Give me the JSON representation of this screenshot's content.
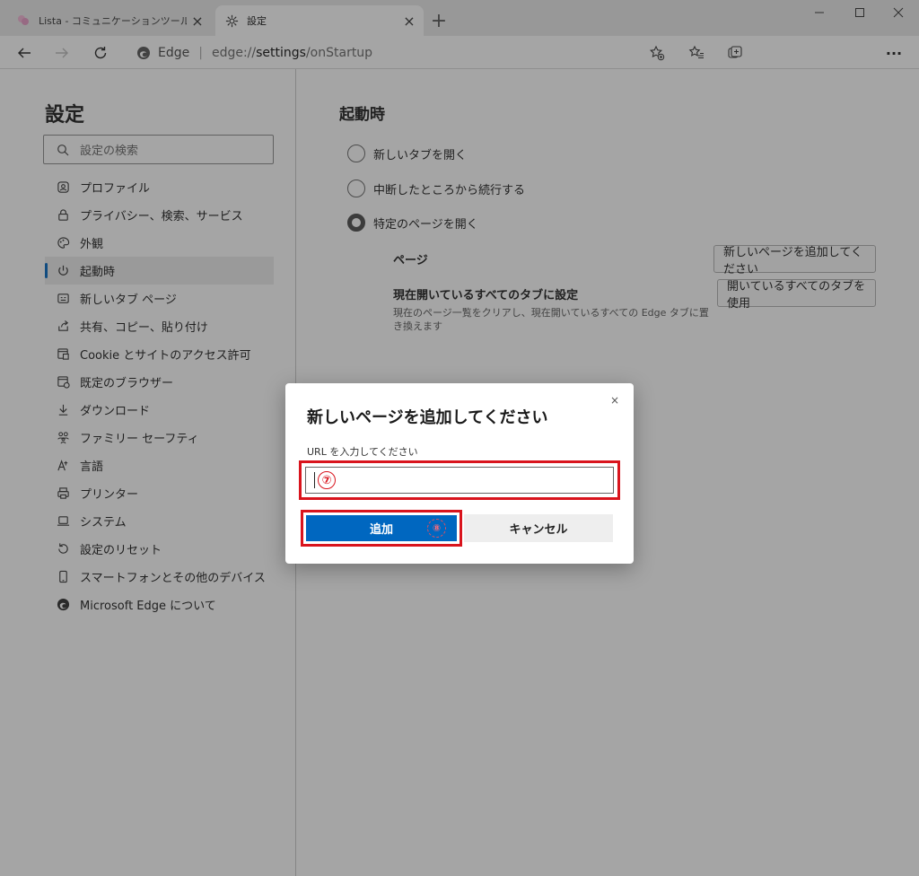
{
  "tabs": [
    {
      "title": "Lista - コミュニケーションツール",
      "close": "×"
    },
    {
      "title": "設定",
      "close": "×"
    }
  ],
  "new_tab_label": "+",
  "window_controls": {
    "minimize": "—",
    "maximize": "☐",
    "close": "✕"
  },
  "address": {
    "edge_label": "Edge",
    "separator": "|",
    "url_proto": "edge://",
    "url_host": "settings",
    "url_path": "/onStartup"
  },
  "toolbar": {
    "more": "···"
  },
  "sidebar": {
    "title": "設定",
    "search_placeholder": "設定の検索",
    "items": [
      {
        "label": "プロファイル",
        "icon": "profile-icon"
      },
      {
        "label": "プライバシー、検索、サービス",
        "icon": "lock-icon"
      },
      {
        "label": "外観",
        "icon": "palette-icon"
      },
      {
        "label": "起動時",
        "icon": "power-icon"
      },
      {
        "label": "新しいタブ ページ",
        "icon": "newtab-page-icon"
      },
      {
        "label": "共有、コピー、貼り付け",
        "icon": "share-icon"
      },
      {
        "label": "Cookie とサイトのアクセス許可",
        "icon": "cookie-site-icon"
      },
      {
        "label": "既定のブラウザー",
        "icon": "default-browser-icon"
      },
      {
        "label": "ダウンロード",
        "icon": "download-icon"
      },
      {
        "label": "ファミリー セーフティ",
        "icon": "family-icon"
      },
      {
        "label": "言語",
        "icon": "language-icon"
      },
      {
        "label": "プリンター",
        "icon": "printer-icon"
      },
      {
        "label": "システム",
        "icon": "laptop-icon"
      },
      {
        "label": "設定のリセット",
        "icon": "reset-icon"
      },
      {
        "label": "スマートフォンとその他のデバイス",
        "icon": "phone-icon"
      },
      {
        "label": "Microsoft Edge について",
        "icon": "edge-logo-icon"
      }
    ]
  },
  "main": {
    "section_title": "起動時",
    "options": [
      {
        "label": "新しいタブを開く",
        "checked": false
      },
      {
        "label": "中断したところから続行する",
        "checked": false
      },
      {
        "label": "特定のページを開く",
        "checked": true
      }
    ],
    "pages_label": "ページ",
    "add_page_button": "新しいページを追加してください",
    "use_open_tabs_label": "現在開いているすべてのタブに設定",
    "use_open_tabs_desc": "現在のページ一覧をクリアし、現在開いているすべての Edge タブに置き換えます",
    "use_open_tabs_button": "開いているすべてのタブを使用"
  },
  "dialog": {
    "title": "新しいページを追加してください",
    "close": "×",
    "input_label": "URL を入力してください",
    "input_step": "⑦",
    "add_button": "追加",
    "add_step": "⑧",
    "cancel_button": "キャンセル"
  },
  "colors": {
    "accent": "#0067c0",
    "highlight": "#d9141d"
  }
}
